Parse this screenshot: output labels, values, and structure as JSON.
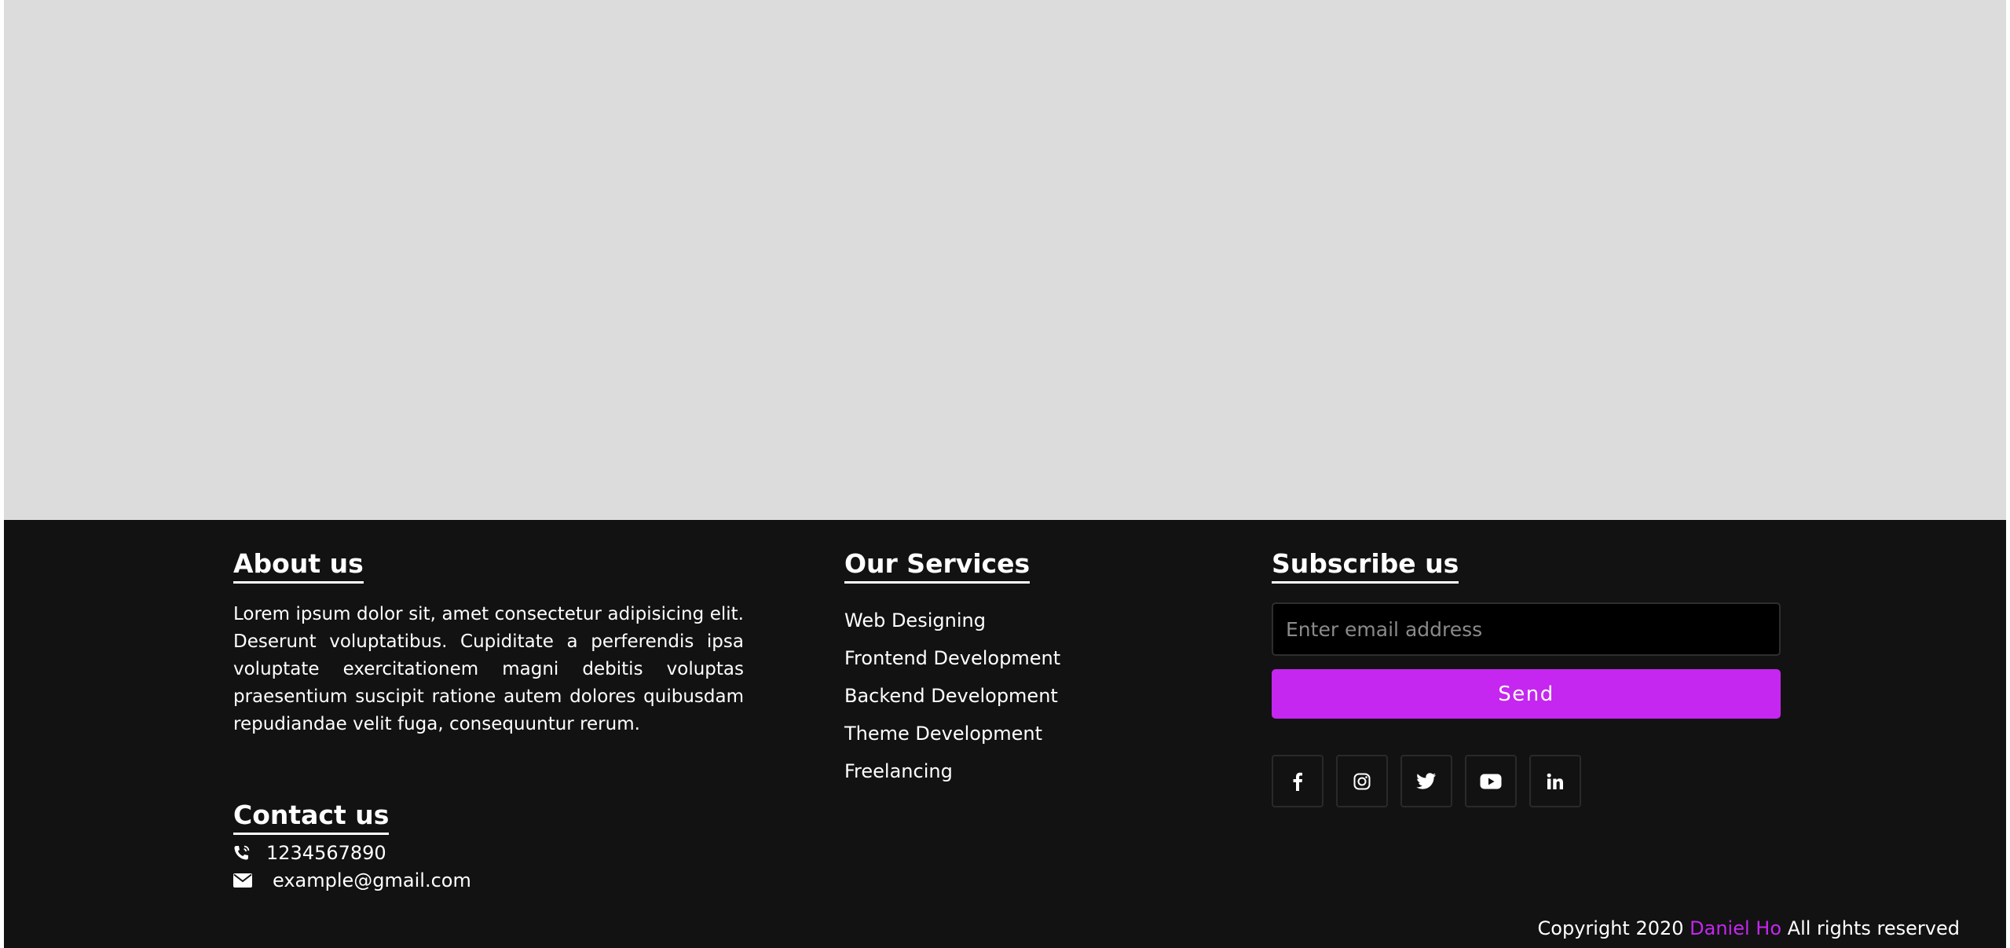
{
  "colors": {
    "footer_bg": "#121212",
    "hero_bg": "#dcdcdc",
    "accent": "#c526f0"
  },
  "about": {
    "heading": "About us",
    "text": "Lorem ipsum dolor sit, amet consectetur adipisicing elit. Deserunt voluptatibus. Cupiditate a perferendis ipsa voluptate exercitationem magni debitis voluptas praesentium suscipit ratione autem dolores quibusdam repudiandae velit fuga, consequuntur rerum."
  },
  "contact": {
    "heading": "Contact us",
    "phone": "1234567890",
    "email": "example@gmail.com",
    "phone_icon": "phone-volume-icon",
    "email_icon": "envelope-icon"
  },
  "services": {
    "heading": "Our Services",
    "items": [
      "Web Designing",
      "Frontend Development",
      "Backend Development",
      "Theme Development",
      "Freelancing"
    ]
  },
  "subscribe": {
    "heading": "Subscribe us",
    "placeholder": "Enter email address",
    "button_label": "Send",
    "social_icons": [
      "facebook-icon",
      "instagram-icon",
      "twitter-icon",
      "youtube-icon",
      "linkedin-icon"
    ]
  },
  "copyright": {
    "prefix": "Copyright 2020 ",
    "brand": "Daniel Ho",
    "suffix": " All rights reserved"
  }
}
